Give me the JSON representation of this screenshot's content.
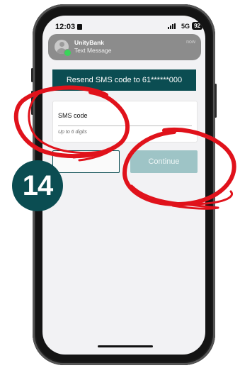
{
  "status_bar": {
    "time": "12:03",
    "network": "5G",
    "battery": "92"
  },
  "notification": {
    "app": "UnityBank",
    "subtitle": "Text Message",
    "time": "now"
  },
  "resend": {
    "label": "Resend SMS code to 61******000"
  },
  "sms_field": {
    "label": "SMS code",
    "placeholder": "Up to 6 digits",
    "value": ""
  },
  "buttons": {
    "back_label": "",
    "continue_label": "Continue"
  },
  "step": {
    "number": "14"
  },
  "colors": {
    "brand": "#0b4d52",
    "button_disabled": "#9ec4c6",
    "annotation": "#e0121b"
  }
}
